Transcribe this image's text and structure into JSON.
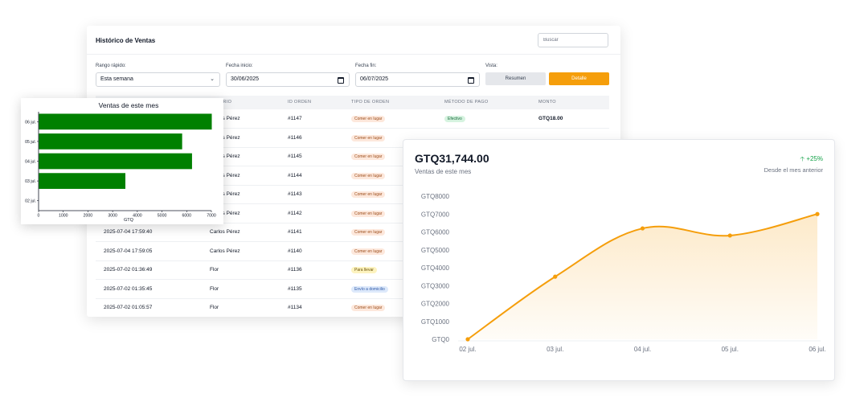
{
  "history": {
    "title": "Histórico de Ventas",
    "search_placeholder": "Buscar",
    "filters": {
      "quick_range_label": "Rango rápido:",
      "quick_range_value": "Esta semana",
      "start_label": "Fecha inicio:",
      "start_value": "30/06/2025",
      "end_label": "Fecha fin:",
      "end_value": "06/07/2025",
      "view_label": "Vista:",
      "view_summary": "Resumen",
      "view_detail": "Detalle"
    },
    "columns": {
      "user": "USUARIO",
      "order_id": "ID ORDEN",
      "order_type": "TIPO DE ORDEN",
      "payment": "MÉTODO DE PAGO",
      "amount": "MONTO"
    },
    "rows": [
      {
        "user": "Carlos Pérez",
        "order_id": "#1147",
        "type": "Comer en lugar",
        "payment": "Efectivo",
        "amount": "GTQ18.00"
      },
      {
        "user": "Carlos Pérez",
        "order_id": "#1146",
        "type": "Comer en lugar"
      },
      {
        "user": "Carlos Pérez",
        "order_id": "#1145",
        "type": "Comer en lugar"
      },
      {
        "user": "Carlos Pérez",
        "order_id": "#1144",
        "type": "Comer en lugar"
      },
      {
        "user": "Carlos Pérez",
        "order_id": "#1143",
        "type": "Comer en lugar"
      },
      {
        "user": "Carlos Pérez",
        "order_id": "#1142",
        "type": "Comer en lugar"
      },
      {
        "date": "2025-07-04 17:59:40",
        "user": "Carlos Pérez",
        "order_id": "#1141",
        "type": "Comer en lugar"
      },
      {
        "date": "2025-07-04 17:59:05",
        "user": "Carlos Pérez",
        "order_id": "#1140",
        "type": "Comer en lugar"
      },
      {
        "date": "2025-07-02 01:36:49",
        "user": "Flor",
        "order_id": "#1136",
        "type": "Para llevar"
      },
      {
        "date": "2025-07-02 01:35:45",
        "user": "Flor",
        "order_id": "#1135",
        "type": "Envío a domicilio"
      },
      {
        "date": "2025-07-02 01:05:57",
        "user": "Flor",
        "order_id": "#1134",
        "type": "Comer en lugar"
      }
    ],
    "colors": {
      "accent": "#f59e0b",
      "badge_dine_in_bg": "#fde8dc",
      "badge_takeout_bg": "#fdf3bf",
      "badge_delivery_bg": "#dde9fb",
      "badge_cash_bg": "#d6f3e0"
    }
  },
  "bar_chart": {
    "title": "Ventas de este mes",
    "xlabel": "GTQ",
    "bar_color": "#008000"
  },
  "line_panel": {
    "total": "GTQ31,744.00",
    "label": "Ventas de este mes",
    "change": "+25%",
    "change_note": "Desde el mes anterior",
    "line_color": "#f59e0b",
    "change_color": "#16a34a"
  },
  "chart_data": [
    {
      "type": "bar",
      "orientation": "horizontal",
      "title": "Ventas de este mes",
      "xlabel": "GTQ",
      "categories": [
        "06 jul.",
        "05 jul.",
        "04 jul.",
        "03 jul.",
        "02 jul."
      ],
      "values": [
        7000,
        5800,
        6200,
        3500,
        0
      ],
      "xlim": [
        0,
        7000
      ],
      "xticks": [
        0,
        1000,
        2000,
        3000,
        4000,
        5000,
        6000,
        7000
      ],
      "grid": false
    },
    {
      "type": "area",
      "categories": [
        "02 jul.",
        "03 jul.",
        "04 jul.",
        "05 jul.",
        "06 jul."
      ],
      "values": [
        0,
        3500,
        6200,
        5800,
        7000
      ],
      "ylim": [
        0,
        8000
      ],
      "yticks": [
        0,
        1000,
        2000,
        3000,
        4000,
        5000,
        6000,
        7000,
        8000
      ],
      "ytick_prefix": "GTQ",
      "grid": false,
      "smooth": true
    }
  ]
}
